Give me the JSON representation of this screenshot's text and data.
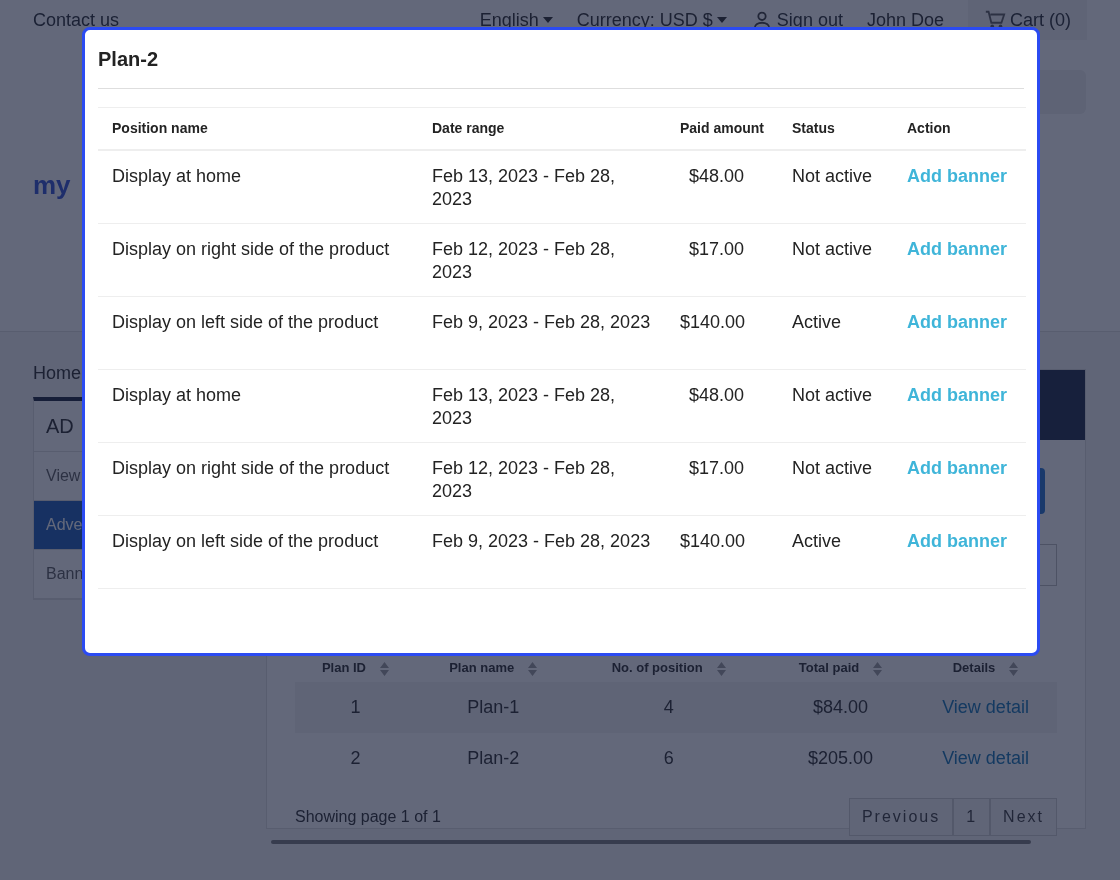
{
  "top_bar": {
    "contact": "Contact us",
    "language": "English",
    "currency": "Currency: USD $",
    "sign_out": "Sign out",
    "user": "John Doe",
    "cart": "Cart (0)"
  },
  "logo": "my",
  "breadcrumb": "Home",
  "sidebar": {
    "title": "AD",
    "items": [
      {
        "label": "View",
        "selected": false
      },
      {
        "label": "Adve",
        "selected": true
      },
      {
        "label": "Bann",
        "selected": false
      }
    ]
  },
  "plans_table": {
    "columns": [
      "Plan ID",
      "Plan name",
      "No. of position",
      "Total paid",
      "Details"
    ],
    "rows": [
      {
        "plan_id": "1",
        "plan_name": "Plan-1",
        "positions": "4",
        "total_paid": "$84.00",
        "details": "View detail"
      },
      {
        "plan_id": "2",
        "plan_name": "Plan-2",
        "positions": "6",
        "total_paid": "$205.00",
        "details": "View detail"
      }
    ],
    "footer": "Showing page 1 of 1",
    "pagination": [
      "Previous",
      "1",
      "Next"
    ]
  },
  "modal": {
    "title": "Plan-2",
    "columns": [
      "Position name",
      "Date range",
      "Paid amount",
      "Status",
      "Action"
    ],
    "rows": [
      {
        "position": "Display at home",
        "date_range": "Feb 13, 2023 - Feb 28, 2023",
        "paid": "$48.00",
        "status": "Not active",
        "action": "Add banner"
      },
      {
        "position": "Display on right side of the product",
        "date_range": "Feb 12, 2023 - Feb 28, 2023",
        "paid": "$17.00",
        "status": "Not active",
        "action": "Add banner"
      },
      {
        "position": "Display on left side of the product",
        "date_range": "Feb 9, 2023 - Feb 28, 2023",
        "paid": "$140.00",
        "status": "Active",
        "action": "Add banner"
      },
      {
        "position": "Display at home",
        "date_range": "Feb 13, 2023 - Feb 28, 2023",
        "paid": "$48.00",
        "status": "Not active",
        "action": "Add banner"
      },
      {
        "position": "Display on right side of the product",
        "date_range": "Feb 12, 2023 - Feb 28, 2023",
        "paid": "$17.00",
        "status": "Not active",
        "action": "Add banner"
      },
      {
        "position": "Display on left side of the product",
        "date_range": "Feb 9, 2023 - Feb 28, 2023",
        "paid": "$140.00",
        "status": "Active",
        "action": "Add banner"
      }
    ]
  }
}
